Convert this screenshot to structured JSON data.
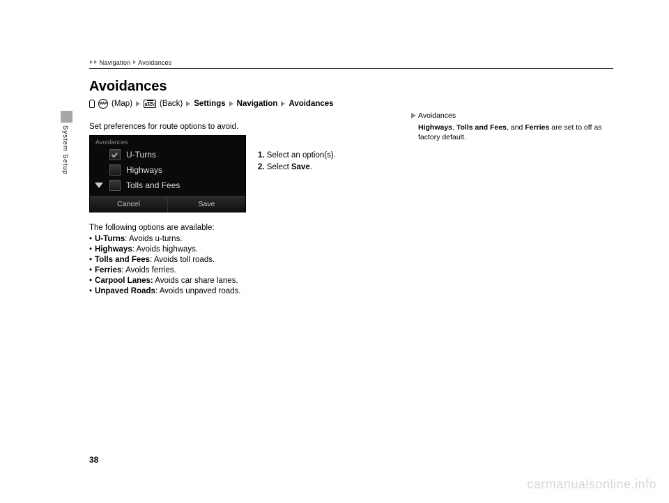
{
  "breadcrumb": {
    "a": "Navigation",
    "b": "Avoidances"
  },
  "title": "Avoidances",
  "side_label": "System Setup",
  "howto": {
    "map": "(Map)",
    "back": "(Back)",
    "settings": "Settings",
    "navigation": "Navigation",
    "avoidances": "Avoidances",
    "map_icon": "MAP",
    "back_icon": "BACK"
  },
  "caption": "Set preferences for route options to avoid.",
  "screenshot": {
    "head": "Avoidances",
    "opt1": "U-Turns",
    "opt2": "Highways",
    "opt3": "Tolls and Fees",
    "cancel": "Cancel",
    "save": "Save"
  },
  "steps": {
    "s1n": "1.",
    "s1": "Select an option(s).",
    "s2n": "2.",
    "s2a": "Select ",
    "s2b": "Save",
    "s2c": "."
  },
  "opts_intro": "The following options are available:",
  "opts": [
    {
      "name": "U-Turns",
      "desc": ": Avoids u-turns."
    },
    {
      "name": "Highways",
      "desc": ": Avoids highways."
    },
    {
      "name": "Tolls and Fees",
      "desc": ": Avoids toll roads."
    },
    {
      "name": "Ferries",
      "desc": ": Avoids ferries."
    },
    {
      "name": "Carpool Lanes:",
      "desc": " Avoids car share lanes."
    },
    {
      "name": "Unpaved Roads",
      "desc": ": Avoids unpaved roads."
    }
  ],
  "side": {
    "head": "Avoidances",
    "b1": "Highways",
    "t1": ", ",
    "b2": "Tolls and Fees",
    "t2": ", and ",
    "b3": "Ferries",
    "t3": " are set to off as factory default."
  },
  "page_number": "38",
  "watermark": "carmanualsonline.info"
}
